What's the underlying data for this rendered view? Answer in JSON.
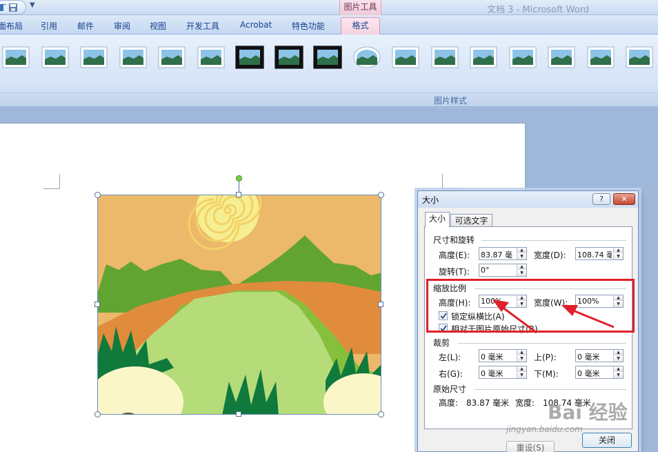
{
  "titlebar": {
    "document_title": "文档 3 - Microsoft Word",
    "context_tools": "图片工具",
    "quick_access_icons": [
      "word-logo-icon",
      "save-icon"
    ]
  },
  "tabs": [
    {
      "label": "页面布局",
      "visible": "面布局"
    },
    {
      "label": "引用"
    },
    {
      "label": "邮件"
    },
    {
      "label": "审阅"
    },
    {
      "label": "视图"
    },
    {
      "label": "开发工具"
    },
    {
      "label": "Acrobat"
    },
    {
      "label": "特色功能"
    }
  ],
  "active_tab": "格式",
  "ribbon": {
    "group_label": "图片样式",
    "gallery_styles": [
      "simple-frame-white",
      "simple-frame-white",
      "beveled-frame",
      "soft-edge",
      "reflected-rounded",
      "soft-edge-rectangle",
      "double-frame-black",
      "thick-matte-black",
      "simple-frame-black",
      "oval-reflection",
      "metal-frame",
      "center-shadow",
      "reflected-bevel",
      "rounded-diagonal",
      "snip-corner",
      "soft-white",
      "rotated-white"
    ]
  },
  "dialog": {
    "title": "大小",
    "help_label": "?",
    "close_glyph": "✕",
    "tabs": {
      "size": "大小",
      "alt_text": "可选文字"
    },
    "size_rotate": {
      "header": "尺寸和旋转",
      "height_label": "高度(E):",
      "height_value": "83.87 毫",
      "width_label": "宽度(D):",
      "width_value": "108.74 毫",
      "rotation_label": "旋转(T):",
      "rotation_value": "0°"
    },
    "scale": {
      "header": "缩放比例",
      "height_label": "高度(H):",
      "height_value": "100%",
      "width_label": "宽度(W):",
      "width_value": "100%",
      "lock_aspect_label": "锁定纵横比(A)",
      "lock_aspect_checked": true,
      "relative_label": "相对于图片原始尺寸(R)",
      "relative_checked": true
    },
    "crop": {
      "header": "裁剪",
      "left_label": "左(L):",
      "left_value": "0 毫米",
      "top_label": "上(P):",
      "top_value": "0 毫米",
      "right_label": "右(G):",
      "right_value": "0 毫米",
      "bottom_label": "下(M):",
      "bottom_value": "0 毫米"
    },
    "original": {
      "header": "原始尺寸",
      "height_label": "高度:",
      "height_value": "83.87 毫米",
      "width_label": "宽度:",
      "width_value": "108.74 毫米"
    },
    "reset_label": "重设(S)",
    "close_label": "关闭"
  },
  "watermark": {
    "brand": "Bai 经验",
    "url": "jingyan.baidu.com"
  },
  "colors": {
    "highlight": "#e0202a",
    "ribbon_blue": "#15428b"
  }
}
